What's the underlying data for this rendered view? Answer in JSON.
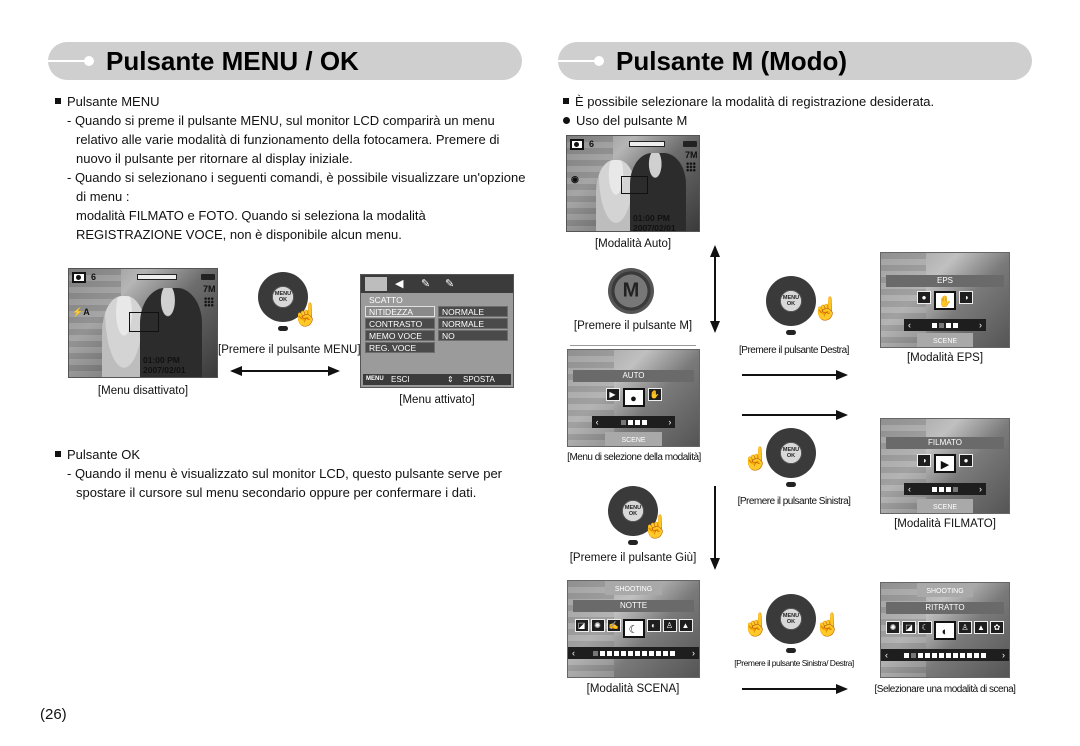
{
  "left": {
    "header": "Pulsante MENU / OK",
    "menu_section": {
      "title": "Pulsante MENU",
      "lines": [
        "- Quando si preme il pulsante MENU, sul monitor LCD comparirà un menu",
        "relativo alle varie modalità di funzionamento della fotocamera. Premere di",
        "nuovo il pulsante per ritornare al display iniziale.",
        "- Quando si selezionano i seguenti comandi, è possibile visualizzare un'opzione",
        "di menu :",
        "modalità FILMATO e FOTO. Quando si seleziona la modalità",
        "REGISTRAZIONE VOCE, non è disponibile alcun menu."
      ]
    },
    "lcd_off": {
      "shots": "6",
      "resolution": "7M",
      "flash": "⚡A",
      "time": "01:00 PM",
      "date": "2007/02/01",
      "caption": "[Menu disattivato]"
    },
    "dial_caption": "[Premere il pulsante MENU]",
    "dial_label": "MENU OK",
    "menu_lcd": {
      "section": "SCATTO",
      "items": [
        {
          "label": "NITIDEZZA",
          "value": "NORMALE"
        },
        {
          "label": "CONTRASTO",
          "value": "NORMALE"
        },
        {
          "label": "MEMO VOCE",
          "value": "NO"
        },
        {
          "label": "REG. VOCE",
          "value": ""
        }
      ],
      "footer_left_key": "MENU",
      "footer_left": "ESCI",
      "footer_right_key": "⇕",
      "footer_right": "SPOSTA",
      "caption": "[Menu attivato]"
    },
    "ok_section": {
      "title": "Pulsante OK",
      "lines": [
        "- Quando il menu è visualizzato sul monitor LCD, questo pulsante serve per",
        "spostare il cursore sul menu secondario oppure per confermare i dati."
      ]
    }
  },
  "right": {
    "header": "Pulsante M (Modo)",
    "intro": "È possibile selezionare la modalità di registrazione desiderata.",
    "sub": "Uso del pulsante M",
    "auto_lcd": {
      "shots": "6",
      "resolution": "7M",
      "time": "01:00 PM",
      "date": "2007/02/01",
      "caption": "[Modalità Auto]"
    },
    "m_button": {
      "label": "M",
      "caption": "[Premere il pulsante M]"
    },
    "mode_menu": {
      "title": "AUTO",
      "footer": "SCENE",
      "caption": "[Menu di selezione della modalità]"
    },
    "down_dial": {
      "caption": "[Premere il pulsante Giù]"
    },
    "scene_screen": {
      "header": "SHOOTING",
      "title": "NOTTE",
      "caption": "[Modalità SCENA]"
    },
    "right_dial": {
      "caption": "[Premere il pulsante Destra]"
    },
    "left_dial": {
      "caption": "[Premere il pulsante Sinistra]"
    },
    "lr_dial": {
      "caption": "[Premere il pulsante Sinistra/ Destra]"
    },
    "eps_screen": {
      "title": "EPS",
      "footer": "SCENE",
      "caption": "[Modalità EPS]"
    },
    "filmato_screen": {
      "title": "FILMATO",
      "footer": "SCENE",
      "caption": "[Modalità FILMATO]"
    },
    "ritratto_screen": {
      "header": "SHOOTING",
      "title": "RITRATTO",
      "caption": "[Selezionare una modalità di scena]"
    }
  },
  "page_number": "(26)"
}
